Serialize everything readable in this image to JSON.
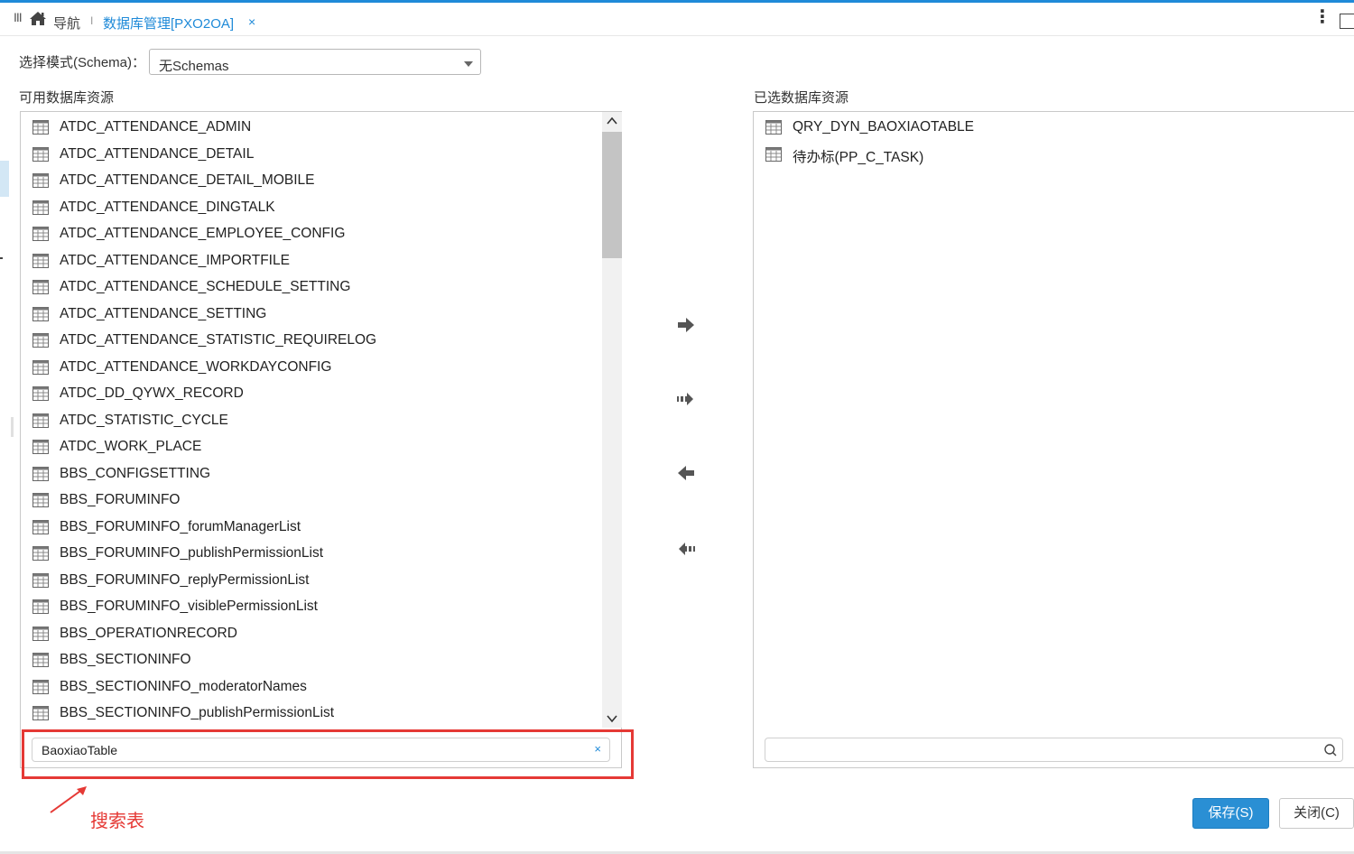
{
  "header": {
    "menu_glyph": "III",
    "nav_label": "导航",
    "separator": "I",
    "tab_label": "数据库管理[PXO2OA]",
    "tab_close": "×",
    "kebab": "⋮"
  },
  "schema": {
    "label": "选择模式(Schema)：",
    "value": "无Schemas"
  },
  "available": {
    "title": "可用数据库资源",
    "items": [
      "ATDC_ATTENDANCE_ADMIN",
      "ATDC_ATTENDANCE_DETAIL",
      "ATDC_ATTENDANCE_DETAIL_MOBILE",
      "ATDC_ATTENDANCE_DINGTALK",
      "ATDC_ATTENDANCE_EMPLOYEE_CONFIG",
      "ATDC_ATTENDANCE_IMPORTFILE",
      "ATDC_ATTENDANCE_SCHEDULE_SETTING",
      "ATDC_ATTENDANCE_SETTING",
      "ATDC_ATTENDANCE_STATISTIC_REQUIRELOG",
      "ATDC_ATTENDANCE_WORKDAYCONFIG",
      "ATDC_DD_QYWX_RECORD",
      "ATDC_STATISTIC_CYCLE",
      "ATDC_WORK_PLACE",
      "BBS_CONFIGSETTING",
      "BBS_FORUMINFO",
      "BBS_FORUMINFO_forumManagerList",
      "BBS_FORUMINFO_publishPermissionList",
      "BBS_FORUMINFO_replyPermissionList",
      "BBS_FORUMINFO_visiblePermissionList",
      "BBS_OPERATIONRECORD",
      "BBS_SECTIONINFO",
      "BBS_SECTIONINFO_moderatorNames",
      "BBS_SECTIONINFO_publishPermissionList"
    ],
    "search_value": "BaoxiaoTable",
    "clear_glyph": "×",
    "scroll_position": 0.0
  },
  "selected": {
    "title": "已选数据库资源",
    "items": [
      "QRY_DYN_BAOXIAOTABLE",
      "待办标(PP_C_TASK)"
    ],
    "search_value": ""
  },
  "annotation": {
    "text": "搜索表",
    "color": "#e53935"
  },
  "buttons": {
    "save": "保存(S)",
    "close": "关闭(C)"
  },
  "colors": {
    "accent": "#1f8ad8",
    "save_bg": "#2a8fd4"
  }
}
